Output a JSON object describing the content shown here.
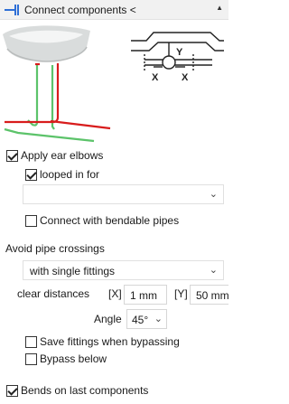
{
  "header": {
    "title": "Connect components <",
    "collapse_icon": "triangle-up-icon"
  },
  "illustration": {
    "diagram_labels": [
      "Y",
      "X",
      "X"
    ]
  },
  "apply_ear_elbows": {
    "label": "Apply ear elbows",
    "checked": true
  },
  "looped_in_for": {
    "label": "looped in for",
    "checked": true
  },
  "loop_select": {
    "value": ""
  },
  "bendable_pipes": {
    "label": "Connect with bendable pipes",
    "checked": false
  },
  "avoid_crossings": {
    "heading": "Avoid pipe crossings",
    "method_value": "with single fittings",
    "clear_distances_label": "clear distances",
    "x_tag": "[X]",
    "x_value": "1 mm",
    "y_tag": "[Y]",
    "y_value": "50 mm",
    "angle_label": "Angle",
    "angle_value": "45°"
  },
  "save_fittings": {
    "label": "Save fittings when bypassing",
    "checked": false
  },
  "bypass_below": {
    "label": "Bypass below",
    "checked": false
  },
  "bends_last": {
    "label": "Bends on last components",
    "checked": true
  },
  "colors": {
    "pipe_green": "#5cc36a",
    "pipe_red": "#d81c1c",
    "accent_blue": "#2e6fd6"
  }
}
